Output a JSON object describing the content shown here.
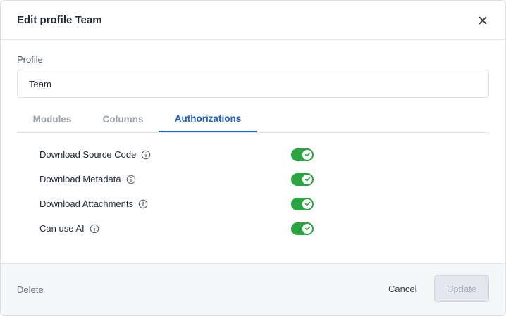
{
  "dialog": {
    "title": "Edit profile Team",
    "close_icon": "close-icon"
  },
  "profile": {
    "label": "Profile",
    "value": "Team"
  },
  "tabs": [
    {
      "label": "Modules",
      "active": false
    },
    {
      "label": "Columns",
      "active": false
    },
    {
      "label": "Authorizations",
      "active": true
    }
  ],
  "authorizations": [
    {
      "label": "Download Source Code",
      "enabled": true,
      "info_icon": "info-icon"
    },
    {
      "label": "Download Metadata",
      "enabled": true,
      "info_icon": "info-icon"
    },
    {
      "label": "Download Attachments",
      "enabled": true,
      "info_icon": "info-icon"
    },
    {
      "label": "Can use AI",
      "enabled": true,
      "info_icon": "info-icon"
    }
  ],
  "footer": {
    "delete_label": "Delete",
    "cancel_label": "Cancel",
    "update_label": "Update"
  },
  "colors": {
    "accent": "#1f5fc9",
    "toggle_on": "#2aa541",
    "update_disabled_bg": "#e4e8ee"
  }
}
